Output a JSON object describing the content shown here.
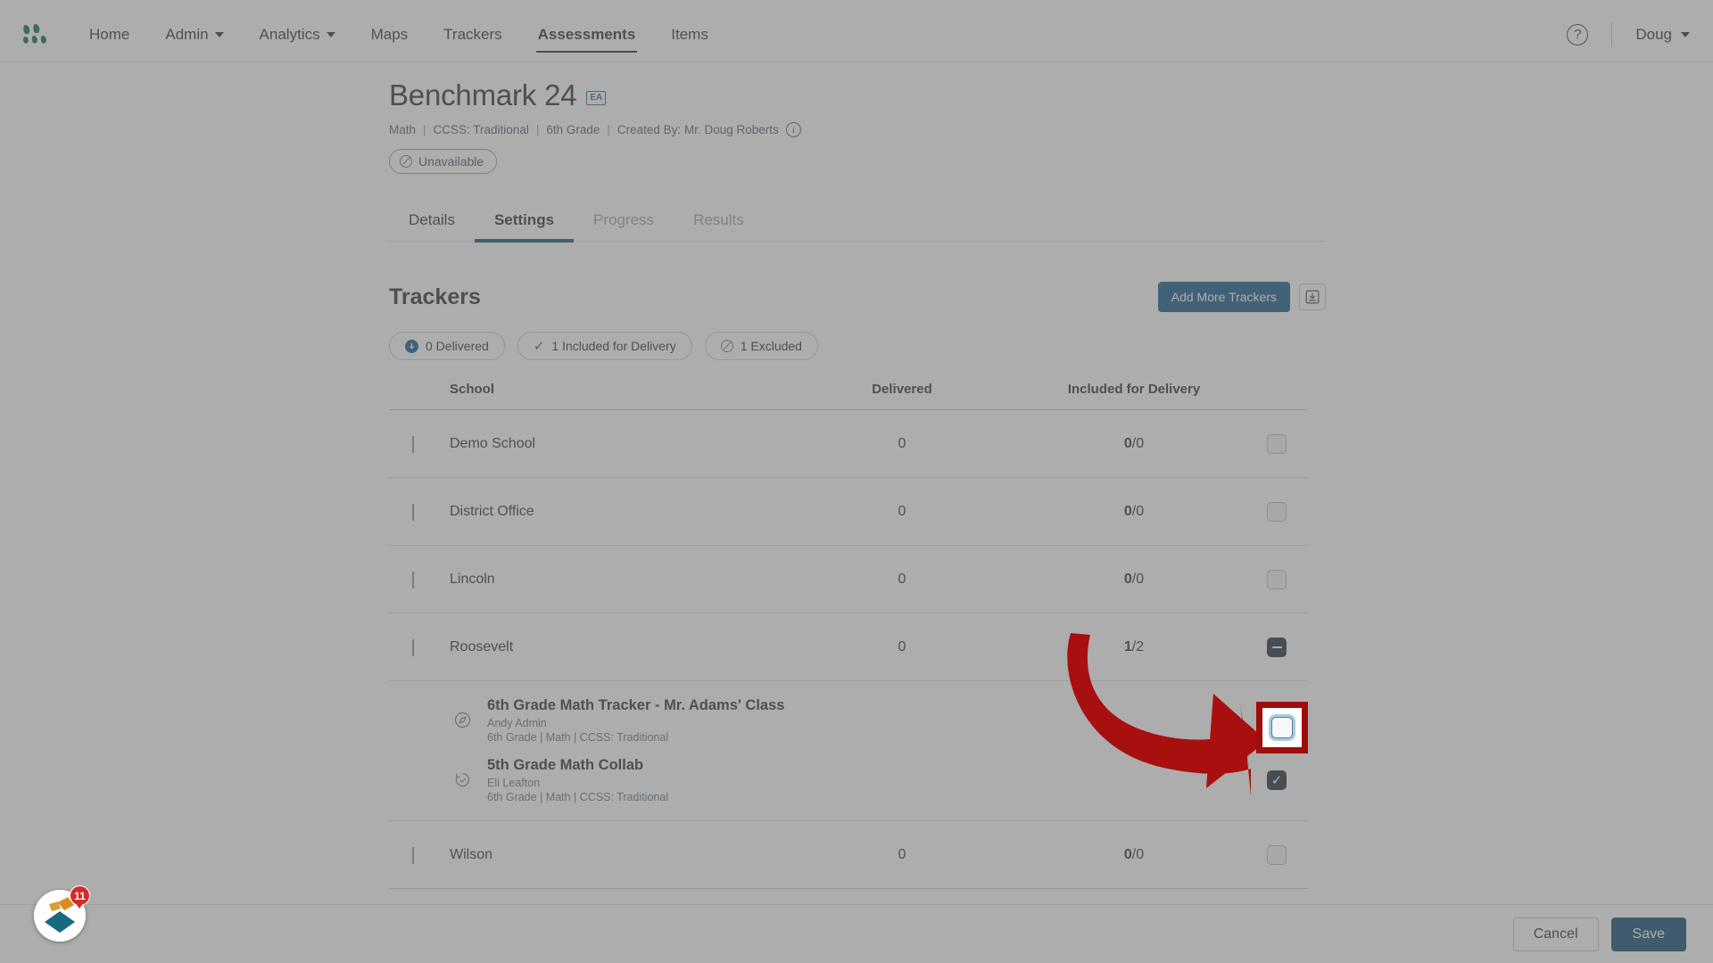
{
  "nav": {
    "logo_name": "app-logo",
    "items": [
      {
        "label": "Home",
        "dropdown": false,
        "active": false
      },
      {
        "label": "Admin",
        "dropdown": true,
        "active": false
      },
      {
        "label": "Analytics",
        "dropdown": true,
        "active": false
      },
      {
        "label": "Maps",
        "dropdown": false,
        "active": false
      },
      {
        "label": "Trackers",
        "dropdown": false,
        "active": false
      },
      {
        "label": "Assessments",
        "dropdown": false,
        "active": true
      },
      {
        "label": "Items",
        "dropdown": false,
        "active": false
      }
    ],
    "help_label": "?",
    "user_label": "Doug"
  },
  "header": {
    "title": "Benchmark 24",
    "badge": "EA",
    "meta": {
      "subject": "Math",
      "standard": "CCSS: Traditional",
      "grade": "6th Grade",
      "creator": "Created By: Mr. Doug Roberts",
      "separator": "|"
    },
    "status": "Unavailable"
  },
  "tabs": [
    {
      "label": "Details",
      "state": "normal"
    },
    {
      "label": "Settings",
      "state": "active"
    },
    {
      "label": "Progress",
      "state": "disabled"
    },
    {
      "label": "Results",
      "state": "disabled"
    }
  ],
  "trackers": {
    "section_title": "Trackers",
    "add_button": "Add More Trackers",
    "export_icon": "download-icon",
    "chips": [
      {
        "label": "0 Delivered",
        "icon": "delivered-dot-icon"
      },
      {
        "label": "1 Included for Delivery",
        "icon": "check-icon"
      },
      {
        "label": "1 Excluded",
        "icon": "ban-icon"
      }
    ],
    "columns": {
      "school": "School",
      "delivered": "Delivered",
      "included": "Included for Delivery"
    },
    "rows": [
      {
        "school": "Demo School",
        "delivered": "0",
        "included_num": "0",
        "included_den": "/0",
        "expanded": false,
        "checkbox": "unchecked"
      },
      {
        "school": "District Office",
        "delivered": "0",
        "included_num": "0",
        "included_den": "/0",
        "expanded": false,
        "checkbox": "unchecked"
      },
      {
        "school": "Lincoln",
        "delivered": "0",
        "included_num": "0",
        "included_den": "/0",
        "expanded": false,
        "checkbox": "unchecked"
      },
      {
        "school": "Roosevelt",
        "delivered": "0",
        "included_num": "1",
        "included_den": "/2",
        "expanded": true,
        "checkbox": "indeterminate"
      },
      {
        "school": "Wilson",
        "delivered": "0",
        "included_num": "0",
        "included_den": "/0",
        "expanded": false,
        "checkbox": "unchecked"
      }
    ],
    "subrows": [
      {
        "icon": "compass-icon",
        "title": "6th Grade Math Tracker - Mr. Adams' Class",
        "owner": "Andy Admin",
        "meta": "6th Grade  |  Math  |  CCSS: Traditional",
        "checkbox": "unchecked-focused"
      },
      {
        "icon": "history-clock-icon",
        "title": "5th Grade Math Collab",
        "owner": "Eli Leafton",
        "meta": "6th Grade  |  Math  |  CCSS: Traditional",
        "checkbox": "checked"
      }
    ]
  },
  "footer": {
    "cancel": "Cancel",
    "save": "Save"
  },
  "widget": {
    "name": "help-beacon",
    "badge_count": "11"
  },
  "colors": {
    "accent_blue": "#105a86",
    "save_blue": "#0f4c70",
    "tab_underline": "#12527a",
    "annotation_red": "#a00c0c",
    "badge_red": "#d32a2a",
    "checkbox_dark": "#1f2b38",
    "logo_green": "#0d6b3f"
  }
}
